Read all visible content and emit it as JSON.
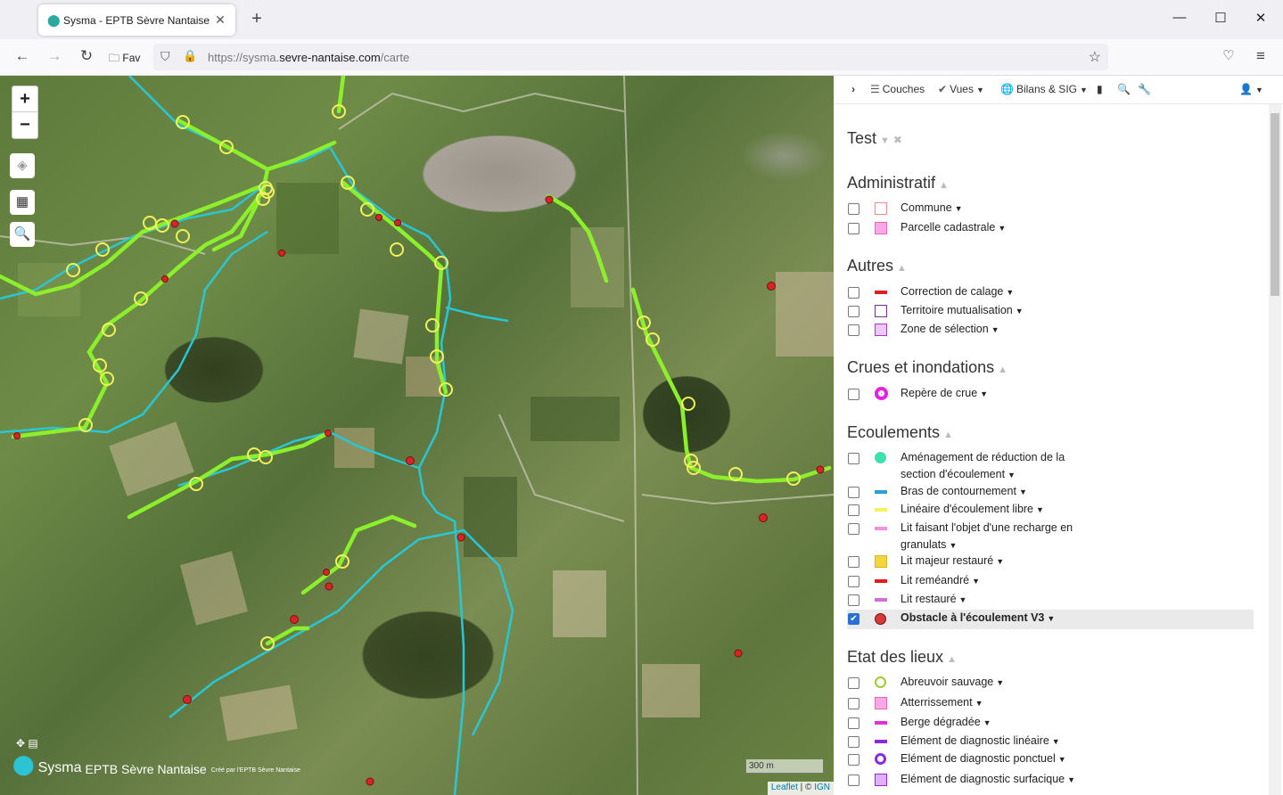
{
  "browser": {
    "tab_title": "Sysma - EPTB Sèvre Nantaise",
    "url_prefix": "https://sysma.",
    "url_domain": "sevre-nantaise.com",
    "url_path": "/carte",
    "fav_label": "Fav"
  },
  "map": {
    "zoom_in": "+",
    "zoom_out": "−",
    "logo_name": "Sysma",
    "logo_org": "EPTB Sèvre Nantaise",
    "logo_credit": "Créé par l'EPTB Sèvre Nantaise",
    "scale_label": "300 m",
    "attribution_leaflet": "Leaflet",
    "attribution_sep": " | © ",
    "attribution_ign": "IGN"
  },
  "toolbar": {
    "layers": "Couches",
    "views": "Vues",
    "reports": "Bilans & SIG"
  },
  "sections": [
    {
      "title": "Test"
    },
    {
      "title": "Administratif",
      "items": [
        {
          "label": "Commune"
        },
        {
          "label": "Parcelle cadastrale"
        }
      ]
    },
    {
      "title": "Autres",
      "items": [
        {
          "label": "Correction de calage"
        },
        {
          "label": "Territoire mutualisation"
        },
        {
          "label": "Zone de sélection"
        }
      ]
    },
    {
      "title": "Crues et inondations",
      "items": [
        {
          "label": "Repère de crue"
        }
      ]
    },
    {
      "title": "Ecoulements",
      "items": [
        {
          "label": "Aménagement de réduction de la",
          "label2": "section d'écoulement"
        },
        {
          "label": "Bras de contournement"
        },
        {
          "label": "Linéaire d'écoulement libre"
        },
        {
          "label": "Lit faisant l'objet d'une recharge en",
          "label2": "granulats"
        },
        {
          "label": "Lit majeur restauré"
        },
        {
          "label": "Lit reméandré"
        },
        {
          "label": "Lit restauré"
        },
        {
          "label": "Obstacle à l'écoulement V3"
        }
      ]
    },
    {
      "title": "Etat des lieux",
      "items": [
        {
          "label": "Abreuvoir sauvage"
        },
        {
          "label": "Atterrissement"
        },
        {
          "label": "Berge dégradée"
        },
        {
          "label": "Elément de diagnostic linéaire"
        },
        {
          "label": "Elément de diagnostic ponctuel"
        },
        {
          "label": "Elément de diagnostic surfacique"
        }
      ]
    }
  ]
}
